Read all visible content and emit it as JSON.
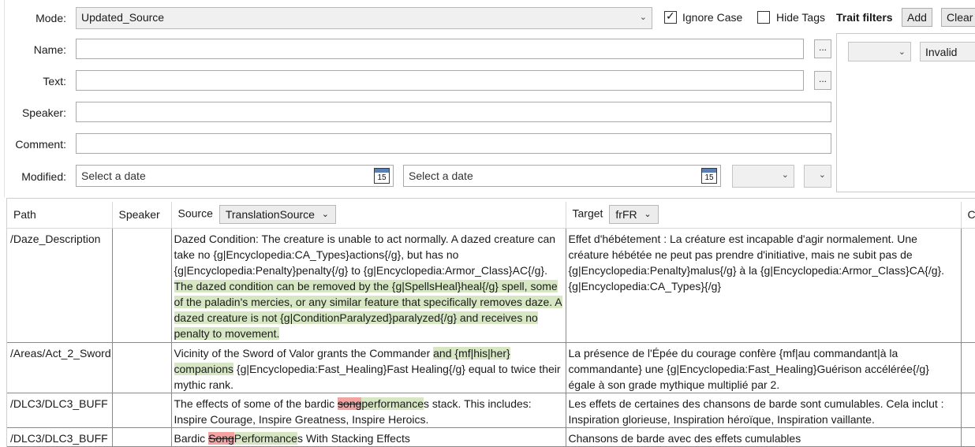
{
  "filters": {
    "mode_label": "Mode:",
    "mode_value": "Updated_Source",
    "ignore_case_label": "Ignore Case",
    "ignore_case_checked": true,
    "hide_tags_label": "Hide Tags",
    "hide_tags_checked": false,
    "trait_filters_label": "Trait filters",
    "add_label": "Add",
    "clear_label": "Clear",
    "name_label": "Name:",
    "name_value": "",
    "text_label": "Text:",
    "text_value": "",
    "speaker_label": "Speaker:",
    "speaker_value": "",
    "comment_label": "Comment:",
    "comment_value": "",
    "modified_label": "Modified:",
    "date_from_placeholder": "Select a date",
    "date_to_placeholder": "Select a date",
    "calendar_day": "15",
    "ellipsis": "...",
    "trait_combo_value": "",
    "trait_state_value": "Invalid"
  },
  "grid": {
    "headers": {
      "path": "Path",
      "speaker": "Speaker",
      "source": "Source",
      "source_combo": "TranslationSource",
      "target": "Target",
      "target_combo": "frFR",
      "comment": "Co"
    },
    "rows": [
      {
        "path": "/Daze_Description",
        "speaker": "",
        "source": {
          "plain": "Dazed Condition: The creature is unable to act normally. A dazed creature can take no {g|Encyclopedia:CA_Types}actions{/g}, but has no {g|Encyclopedia:Penalty}penalty{/g} to {g|Encyclopedia:Armor_Class}AC{/g}. ",
          "inserted": "The dazed condition can be removed by the {g|SpellsHeal}heal{/g} spell, some of the paladin's mercies, or any similar feature that specifically removes daze. A dazed creature is not {g|ConditionParalyzed}paralyzed{/g} and receives no penalty to movement."
        },
        "target": "Effet d'hébétement : La créature est incapable d'agir normalement. Une créature hébétée ne peut pas prendre d'initiative, mais ne subit pas de {g|Encyclopedia:Penalty}malus{/g} à la {g|Encyclopedia:Armor_Class}CA{/g}.{g|Encyclopedia:CA_Types}{/g}"
      },
      {
        "path": "/Areas/Act_2_Sword",
        "speaker": "",
        "source": {
          "a": "Vicinity of the Sword of Valor grants the Commander ",
          "ins": "and {mf|his|her} companions",
          "b": " {g|Encyclopedia:Fast_Healing}Fast Healing{/g} equal to twice their mythic rank."
        },
        "target": "La présence de l'Épée du courage confère {mf|au commandant|à la commandante} une {g|Encyclopedia:Fast_Healing}Guérison accélérée{/g} égale à son grade mythique multiplié par 2."
      },
      {
        "path": "/DLC3/DLC3_BUFF",
        "speaker": "",
        "source": {
          "a": "The effects of some of the bardic ",
          "del": "song",
          "ins": "performance",
          "b": "s stack. This includes: Inspire Courage, Inspire Greatness, Inspire Heroics."
        },
        "target": "Les effets de certaines des chansons de barde sont cumulables. Cela inclut : Inspiration glorieuse, Inspiration héroïque, Inspiration vaillante."
      },
      {
        "path": "/DLC3/DLC3_BUFF",
        "speaker": "",
        "source": {
          "a": "Bardic ",
          "del": "Song",
          "ins": "Performance",
          "b": "s With Stacking Effects"
        },
        "target": "Chansons de barde avec des effets cumulables"
      }
    ]
  }
}
